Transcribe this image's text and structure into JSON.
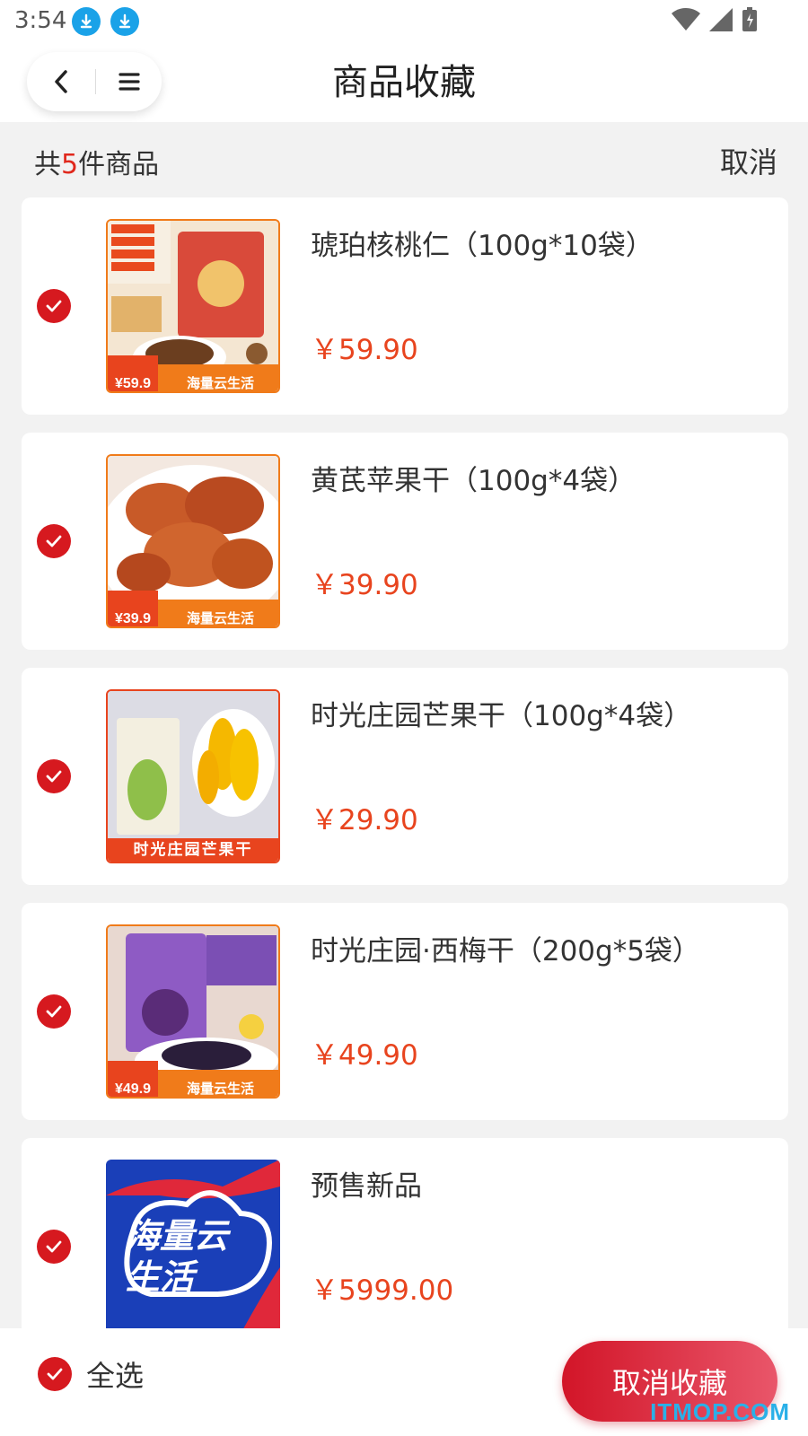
{
  "status_bar": {
    "time": "3:54"
  },
  "header": {
    "title": "商品收藏"
  },
  "summary": {
    "prefix": "共",
    "count": "5",
    "suffix": "件商品",
    "cancel_label": "取消"
  },
  "items": [
    {
      "name": "琥珀核桃仁（100g*10袋）",
      "price": "￥59.90",
      "image": "walnut-product-image"
    },
    {
      "name": "黄芪苹果干（100g*4袋）",
      "price": "￥39.90",
      "image": "apple-chips-product-image"
    },
    {
      "name": "时光庄园芒果干（100g*4袋）",
      "price": "￥29.90",
      "image": "mango-product-image",
      "image_caption": "时光庄园芒果干"
    },
    {
      "name": "时光庄园·西梅干（200g*5袋）",
      "price": "￥49.90",
      "image": "prune-product-image"
    },
    {
      "name": "预售新品",
      "price": "￥5999.00",
      "image": "brand-logo-image",
      "image_caption": "海量云生活"
    }
  ],
  "bottom_bar": {
    "select_all_label": "全选",
    "uncollect_label": "取消收藏"
  },
  "watermark": "ITMOP.COM",
  "colors": {
    "accent": "#d6191f",
    "price": "#e8441e",
    "count": "#e0281c"
  }
}
